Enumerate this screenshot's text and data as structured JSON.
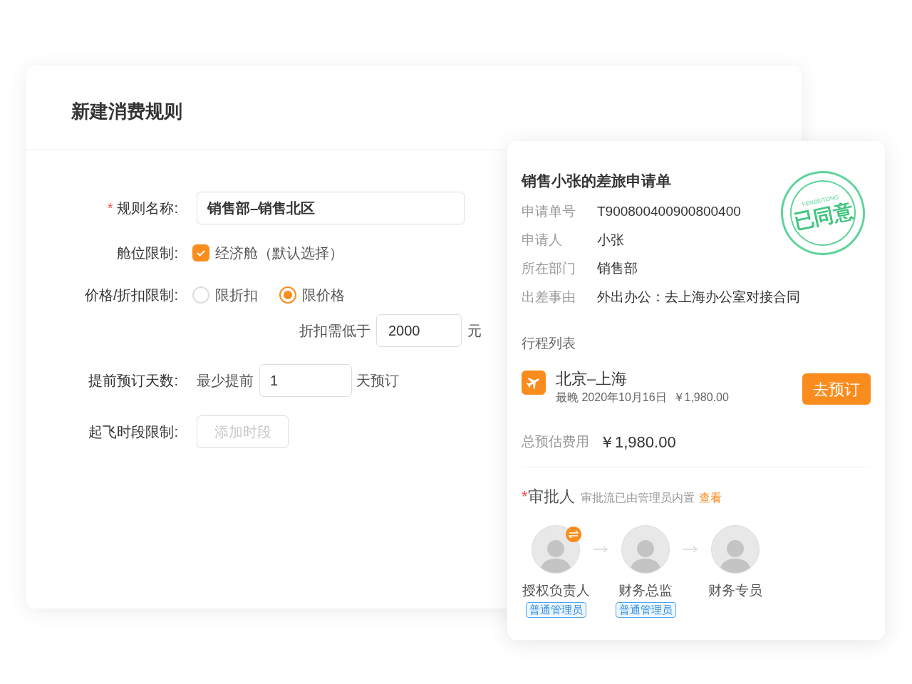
{
  "rule_form": {
    "title": "新建消费规则",
    "name_field": {
      "required_mark": "*",
      "label": "规则名称:",
      "value": "销售部–销售北区"
    },
    "cabin": {
      "label": "舱位限制:",
      "option": "经济舱（默认选择）",
      "checked": true
    },
    "price": {
      "label": "价格/折扣限制:",
      "options": [
        {
          "label": "限折扣",
          "selected": false
        },
        {
          "label": "限价格",
          "selected": true
        }
      ],
      "prefix": "折扣需低于",
      "value": "2000",
      "suffix": "元"
    },
    "advance": {
      "label": "提前预订天数:",
      "prefix": "最少提前",
      "value": "1",
      "suffix": "天预订"
    },
    "time_slot": {
      "label": "起飞时段限制:",
      "button": "添加时段"
    }
  },
  "request": {
    "title": "销售小张的差旅申请单",
    "stamp": {
      "ring_text": "FENBEITONG",
      "text": "已同意"
    },
    "fields": [
      {
        "label": "申请单号",
        "value": "T900800400900800400"
      },
      {
        "label": "申请人",
        "value": "小张"
      },
      {
        "label": "所在部门",
        "value": "销售部"
      },
      {
        "label": "出差事由",
        "value": "外出办公：去上海办公室对接合同"
      }
    ],
    "trips_heading": "行程列表",
    "trips": [
      {
        "route": "北京–上海",
        "detail": "最晚 2020年10月16日  ￥1,980.00",
        "button": "去预订"
      }
    ],
    "total_label": "总预估费用",
    "total": "￥1,980.00",
    "approvers_heading": {
      "required_mark": "*",
      "label": "审批人",
      "note": "审批流已由管理员内置",
      "link": "查看"
    },
    "approvers": [
      {
        "name": "授权负责人",
        "role": "普通管理员",
        "swap": true
      },
      {
        "name": "财务总监",
        "role": "普通管理员",
        "swap": false
      },
      {
        "name": "财务专员",
        "swap": false
      }
    ]
  }
}
